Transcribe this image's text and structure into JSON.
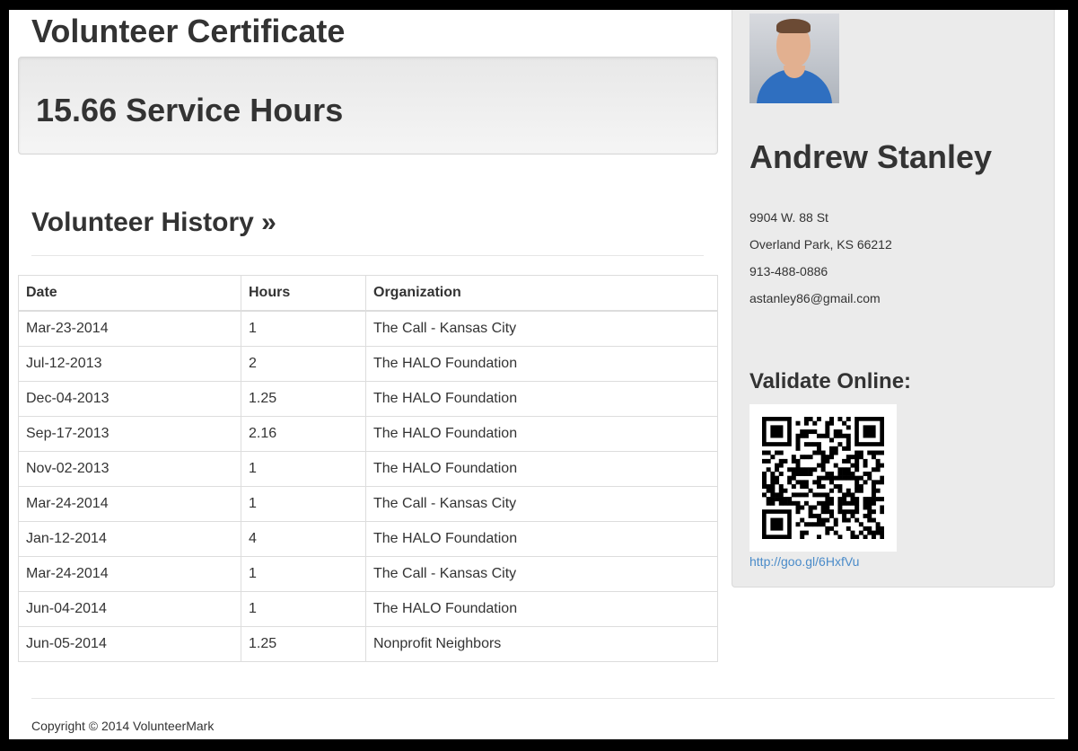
{
  "page": {
    "title": "Volunteer Certificate",
    "service_hours": "15.66 Service Hours"
  },
  "history": {
    "heading": "Volunteer History »",
    "columns": [
      "Date",
      "Hours",
      "Organization"
    ],
    "rows": [
      {
        "date": "Mar-23-2014",
        "hours": "1",
        "org": "The Call - Kansas City"
      },
      {
        "date": "Jul-12-2013",
        "hours": "2",
        "org": "The HALO Foundation"
      },
      {
        "date": "Dec-04-2013",
        "hours": "1.25",
        "org": "The HALO Foundation"
      },
      {
        "date": "Sep-17-2013",
        "hours": "2.16",
        "org": "The HALO Foundation"
      },
      {
        "date": "Nov-02-2013",
        "hours": "1",
        "org": "The HALO Foundation"
      },
      {
        "date": "Mar-24-2014",
        "hours": "1",
        "org": "The Call - Kansas City"
      },
      {
        "date": "Jan-12-2014",
        "hours": "4",
        "org": "The HALO Foundation"
      },
      {
        "date": "Mar-24-2014",
        "hours": "1",
        "org": "The Call - Kansas City"
      },
      {
        "date": "Jun-04-2014",
        "hours": "1",
        "org": "The HALO Foundation"
      },
      {
        "date": "Jun-05-2014",
        "hours": "1.25",
        "org": "Nonprofit Neighbors"
      }
    ]
  },
  "profile": {
    "name": "Andrew Stanley",
    "address_line1": "9904 W. 88 St",
    "address_line2": "Overland Park, KS 66212",
    "phone": "913-488-0886",
    "email": "astanley86@gmail.com",
    "validate_label": "Validate Online:",
    "validate_url": "http://goo.gl/6HxfVu"
  },
  "footer": {
    "copyright": "Copyright © 2014 VolunteerMark"
  },
  "colors": {
    "link": "#4a8bc9",
    "sidebar_bg": "#ebebeb",
    "text": "#333333"
  }
}
